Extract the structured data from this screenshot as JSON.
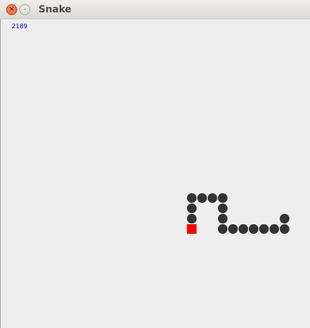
{
  "window": {
    "title": "Snake",
    "close_glyph": "×",
    "minimize_glyph": "–"
  },
  "game": {
    "score": "2189",
    "snake_color": "#333333",
    "food_color": "#ff0000",
    "score_color": "#0000cc",
    "cell_size": 15,
    "snake_cells": [
      [
        18,
        17
      ],
      [
        19,
        17
      ],
      [
        20,
        17
      ],
      [
        21,
        17
      ],
      [
        18,
        18
      ],
      [
        21,
        18
      ],
      [
        18,
        19
      ],
      [
        21,
        19
      ],
      [
        27,
        19
      ],
      [
        21,
        20
      ],
      [
        22,
        20
      ],
      [
        23,
        20
      ],
      [
        24,
        20
      ],
      [
        25,
        20
      ],
      [
        26,
        20
      ],
      [
        27,
        20
      ]
    ],
    "food_cell": [
      18,
      20
    ]
  }
}
